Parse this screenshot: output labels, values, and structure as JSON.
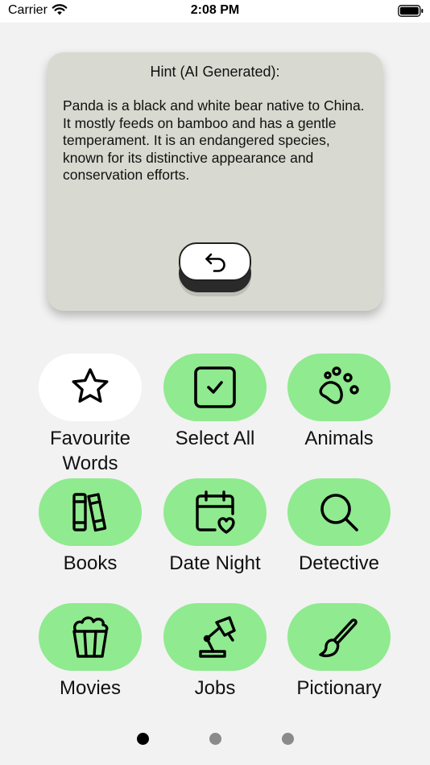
{
  "status_bar": {
    "carrier": "Carrier",
    "time": "2:08 PM",
    "wifi_icon": "wifi-icon",
    "battery_icon": "battery-icon"
  },
  "hint": {
    "title": "Hint (AI Generated):",
    "text": "Panda is a black and white bear native to China. It mostly feeds on bamboo and has a gentle temperament. It is an endangered species, known for its distinctive appearance and conservation efforts.",
    "back_icon": "undo-arrow-icon"
  },
  "categories": [
    {
      "label": "Favourite Words",
      "icon": "star-icon",
      "selected": false
    },
    {
      "label": "Select All",
      "icon": "checkbox-icon",
      "selected": true
    },
    {
      "label": "Animals",
      "icon": "paw-icon",
      "selected": true
    },
    {
      "label": "Books",
      "icon": "books-icon",
      "selected": true
    },
    {
      "label": "Date Night",
      "icon": "calendar-heart-icon",
      "selected": true
    },
    {
      "label": "Detective",
      "icon": "magnifier-icon",
      "selected": true
    },
    {
      "label": "Movies",
      "icon": "popcorn-icon",
      "selected": true
    },
    {
      "label": "Jobs",
      "icon": "desk-lamp-icon",
      "selected": true
    },
    {
      "label": "Pictionary",
      "icon": "paintbrush-icon",
      "selected": true
    }
  ],
  "pagination": {
    "pages": 3,
    "current": 1
  },
  "colors": {
    "selected_pill": "#90ea8f",
    "unselected_pill": "#ffffff",
    "card": "#d8d9d0",
    "background": "#f2f2f2"
  }
}
